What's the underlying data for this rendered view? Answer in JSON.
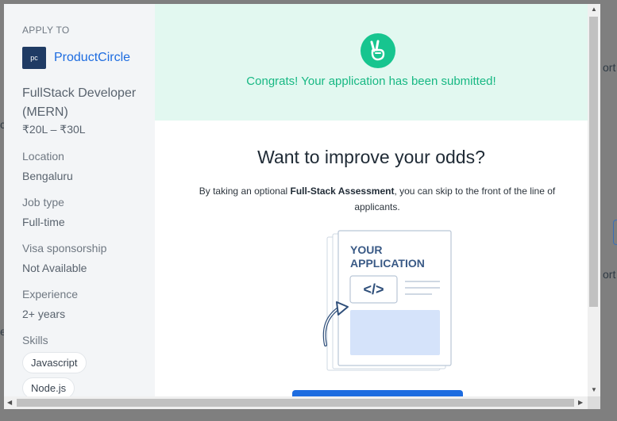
{
  "background": {
    "right_fragment_1": "ort",
    "right_fragment_2": "ort",
    "left_fragment_1": "c",
    "left_fragment_2": "e"
  },
  "sidebar": {
    "apply_to": "APPLY TO",
    "logo_text": "pc",
    "company": "ProductCircle",
    "job_title": "FullStack Developer (MERN)",
    "salary": "₹20L – ₹30L",
    "fields": [
      {
        "label": "Location",
        "value": "Bengaluru"
      },
      {
        "label": "Job type",
        "value": "Full-time"
      },
      {
        "label": "Visa sponsorship",
        "value": "Not Available"
      },
      {
        "label": "Experience",
        "value": "2+ years"
      }
    ],
    "skills_label": "Skills",
    "skills": [
      "Javascript",
      "Node.js"
    ]
  },
  "main": {
    "congrats": "Congrats! Your application has been submitted!",
    "heading": "Want to improve your odds?",
    "desc_prefix": "By taking an optional ",
    "desc_bold": "Full-Stack Assessment",
    "desc_suffix": ", you can skip to the front of the line of applicants.",
    "illustration_title_line1": "YOUR",
    "illustration_title_line2": "APPLICATION",
    "code_symbol": "</>"
  },
  "colors": {
    "accent_green": "#17c58f",
    "brand_blue": "#1d6ce0",
    "banner_bg": "#e2f8f0"
  },
  "icons": {
    "banner": "peace-hand-icon",
    "code": "code-icon",
    "arrow": "curved-arrow-icon"
  }
}
